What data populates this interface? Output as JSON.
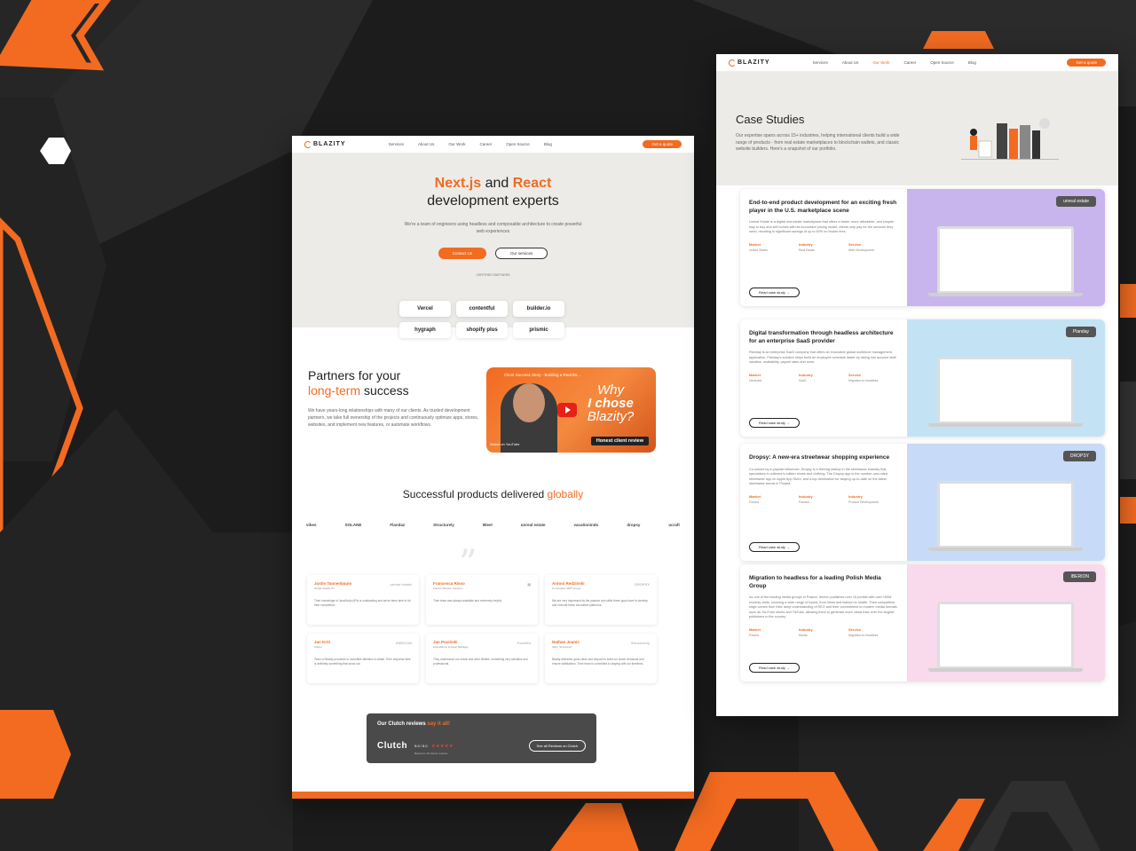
{
  "colors": {
    "accent": "#f26b21",
    "background": "#1e1e1e"
  },
  "page1": {
    "nav": {
      "logo": "BLAZITY",
      "links": [
        "Services",
        "About Us",
        "Our Work",
        "Career",
        "Open Source",
        "Blog"
      ],
      "cta": "Get a quote"
    },
    "hero": {
      "title_a": "Next.js",
      "title_and": " and ",
      "title_b": "React",
      "title_line2": "development experts",
      "subtitle": "We're a team of engineers using headless and composable architecture to create powerful web experiences",
      "btn_primary": "Contact Us",
      "btn_secondary": "Our services",
      "certified": "CERTIFIED PARTNERS"
    },
    "partners": [
      "Vercel",
      "contentful",
      "builder.io",
      "hygraph",
      "shopify plus",
      "prismic"
    ],
    "partners_section": {
      "title_a": "Partners for your",
      "title_b": "long-term",
      "title_c": " success",
      "text": "We have years-long relationships with many of our clients. As trusted development partners, we take full ownership of the projects and continuously optimize apps, stores, websites, and implement new features, or automate workflows."
    },
    "video": {
      "title": "Client Success Story - Building a Real Es...",
      "big_line1": "Why",
      "big_line2": "I chose",
      "big_line3": "Blazity?",
      "badge": "Honest client review",
      "watch": "Watch on YouTube"
    },
    "products": {
      "title_a": "Successful products delivered ",
      "title_b": "globally",
      "logos": [
        "vibes",
        "SOLANE",
        "Flandaz",
        "Structurely",
        "Bleel",
        "unreal estate",
        "vacationindo",
        "dropsy",
        "ucraft"
      ]
    },
    "testimonials": [
      {
        "name": "Justin Tannenbaum",
        "role": "Ocean Realty ITI",
        "logo": "unreal estate",
        "text": "Their knowledge of JavaScript APIs is outstanding and we've been able to hit their competition."
      },
      {
        "name": "Francesca Risso",
        "role": "Former Director, Dexcom",
        "logo": "",
        "text": "Their team was always available and extremely helpful."
      },
      {
        "name": "Antoni Redziński",
        "role": "Co-founder, RMT Group",
        "logo": "DROPSY",
        "text": "We are very impressed by the passion and skills these guys have to develop and execute these innovative platforms."
      },
      {
        "name": "Jan Król",
        "role": "Owner",
        "logo": "ISEECON",
        "text": "Team of Blazity proceeds to incredible attention to detail. Their response time is definitely something that stood out."
      },
      {
        "name": "Jan Pociński",
        "role": "Acquisitions & Asset Manager",
        "logo": "FoodKit",
        "text": "They understood our needs and were flexible, something very sensitive and professional."
      },
      {
        "name": "Nathan Joanis",
        "role": "CEO, Structurely",
        "logo": "Structurely",
        "text": "Blazity delivered good-clean and beyond to build our clutch demands and ensure satisfaction. Their team is committed to staying with our timelines."
      }
    ],
    "clutch": {
      "title_a": "Our Clutch reviews ",
      "title_b": "say it all!",
      "logo": "Clutch",
      "rating": "5.0 / 5.0",
      "stars": "★★★★★",
      "sub": "Based on 16 clients reviews",
      "button": "See all Reviews on Clutch"
    }
  },
  "page2": {
    "nav": {
      "logo": "BLAZITY",
      "links": [
        "Services",
        "About Us",
        "Our Work",
        "Career",
        "Open Source",
        "Blog"
      ],
      "active": "Our Work",
      "cta": "Get a quote"
    },
    "hero": {
      "title": "Case Studies",
      "text": "Our expertise spans across 15+ industries, helping international clients build a wide range of products - from real estate marketplaces to blockchain wallets, and classic website builders. Here's a snapshot of our portfolio."
    },
    "cases": [
      {
        "title": "End-to-end product development for an exciting fresh player in the U.S. marketplace scene",
        "desc": "Unreal Estate is a digital real estate marketplace that offers a faster, more affordable, and simpler way to buy and sell homes with its innovative pricing model, clients only pay for the services they need, resulting in significant savings of up to 50% on broker fees.",
        "market_label": "Market",
        "market": "United States",
        "industry_label": "Industry",
        "industry": "Real Estate",
        "service_label": "Service",
        "service": "Web Development",
        "button": "Read case study",
        "logo": "unreal estate",
        "bg": "#c8b5ee"
      },
      {
        "title": "Digital transformation through headless architecture for an enterprise SaaS provider",
        "desc": "Planday is an enterprise SaaS company that offers an innovative global workforce management application. Planday's solution helps build an employee schedule faster by taking into account staff vacation, availability, payroll rates and more.",
        "market_label": "Market",
        "market": "Denmark",
        "industry_label": "Industry",
        "industry": "SaaS",
        "service_label": "Service",
        "service": "Migration to headless",
        "button": "Read case study",
        "logo": "Planday",
        "bg": "#c3e3f5"
      },
      {
        "title": "Dropsy: A new-era streetwear shopping experience",
        "desc": "Co-owned by a popular influencer, Dropsy is a thriving startup in the streetwear industry that specializes in collector's edition shoes and clothing. The Dropsy app is the number-one-rated streetwear app on Apple App Store, and a top destination for staying up-to-date on the latest streetwear trends in Poland.",
        "market_label": "Market",
        "market": "Poland",
        "industry_label": "Industry",
        "industry": "Fashion",
        "service_label": "Industry",
        "service": "Product Development",
        "button": "Read case study",
        "logo": "DROPSY",
        "bg": "#c7dbf8"
      },
      {
        "title": "Migration to headless for a leading Polish Media Group",
        "desc": "As one of the leading media groups in Poland, Iberion publishes over 15 portals with over 150M monthly visits, covering a wide range of topics, from news and fashion to health. Their competitive edge comes from their deep understanding of SEO and their commitment to modern media formats, such as YouTube shorts and TikToks, allowing them to generate more views than ever the largest publishers in the country.",
        "market_label": "Market",
        "market": "Poland",
        "industry_label": "Industry",
        "industry": "Media",
        "service_label": "Service",
        "service": "Migration to headless",
        "button": "Read case study",
        "logo": "IBERION",
        "bg": "#f9d9ec"
      }
    ]
  }
}
